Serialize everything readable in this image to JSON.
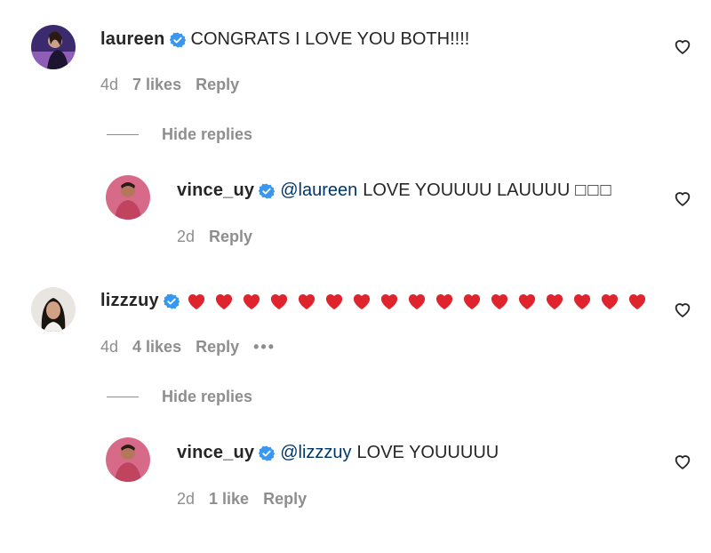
{
  "comments": [
    {
      "username": "laureen",
      "text": "CONGRATS I LOVE YOU BOTH!!!!",
      "time": "4d",
      "likes": "7 likes",
      "reply": "Reply",
      "hide_replies": "Hide replies",
      "replies": [
        {
          "username": "vince_uy",
          "mention": "@laureen",
          "text": "LOVE YOUUUU LAUUUU",
          "extra": "□□□",
          "time": "2d",
          "reply": "Reply"
        }
      ]
    },
    {
      "username": "lizzzuy",
      "emoji_count": 17,
      "time": "4d",
      "likes": "4 likes",
      "reply": "Reply",
      "more": "•••",
      "hide_replies": "Hide replies",
      "replies": [
        {
          "username": "vince_uy",
          "mention": "@lizzzuy",
          "text": "LOVE YOUUUUU",
          "time": "2d",
          "likes": "1 like",
          "reply": "Reply"
        }
      ]
    }
  ],
  "colors": {
    "text": "#262626",
    "meta": "#8e8e8e",
    "mention": "#00376b",
    "verified": "#3897f0",
    "heart_emoji": "#e0242e"
  },
  "icons": [
    "verified-badge-icon",
    "heart-outline-icon",
    "red-heart-emoji-icon"
  ]
}
